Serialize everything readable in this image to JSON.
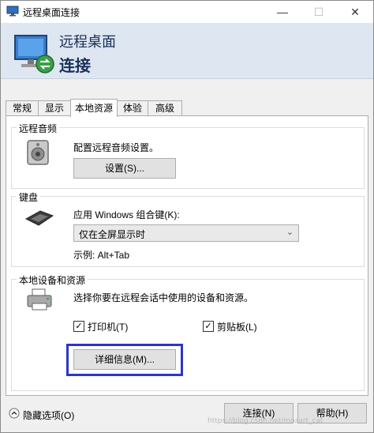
{
  "window": {
    "title": "远程桌面连接",
    "controls": {
      "minimize": "—",
      "maximize": "☐",
      "close": "✕"
    }
  },
  "banner": {
    "line1": "远程桌面",
    "line2": "连接"
  },
  "tabs": [
    {
      "label": "常规"
    },
    {
      "label": "显示"
    },
    {
      "label": "本地资源",
      "active": true
    },
    {
      "label": "体验"
    },
    {
      "label": "高级"
    }
  ],
  "audio": {
    "group_label": "远程音频",
    "description": "配置远程音频设置。",
    "settings_button": "设置(S)..."
  },
  "keyboard": {
    "group_label": "键盘",
    "description": "应用 Windows 组合键(K):",
    "selected_option": "仅在全屏显示时",
    "example": "示例: Alt+Tab"
  },
  "local_devices": {
    "group_label": "本地设备和资源",
    "description": "选择你要在远程会话中使用的设备和资源。",
    "printer_label": "打印机(T)",
    "printer_checked": true,
    "clipboard_label": "剪贴板(L)",
    "clipboard_checked": true,
    "details_button": "详细信息(M)..."
  },
  "footer": {
    "hide_options": "隐藏选项(O)",
    "connect_button": "连接(N)",
    "help_button": "帮助(H)"
  },
  "watermark": "https://blog.csdn.net/mozart_cat"
}
